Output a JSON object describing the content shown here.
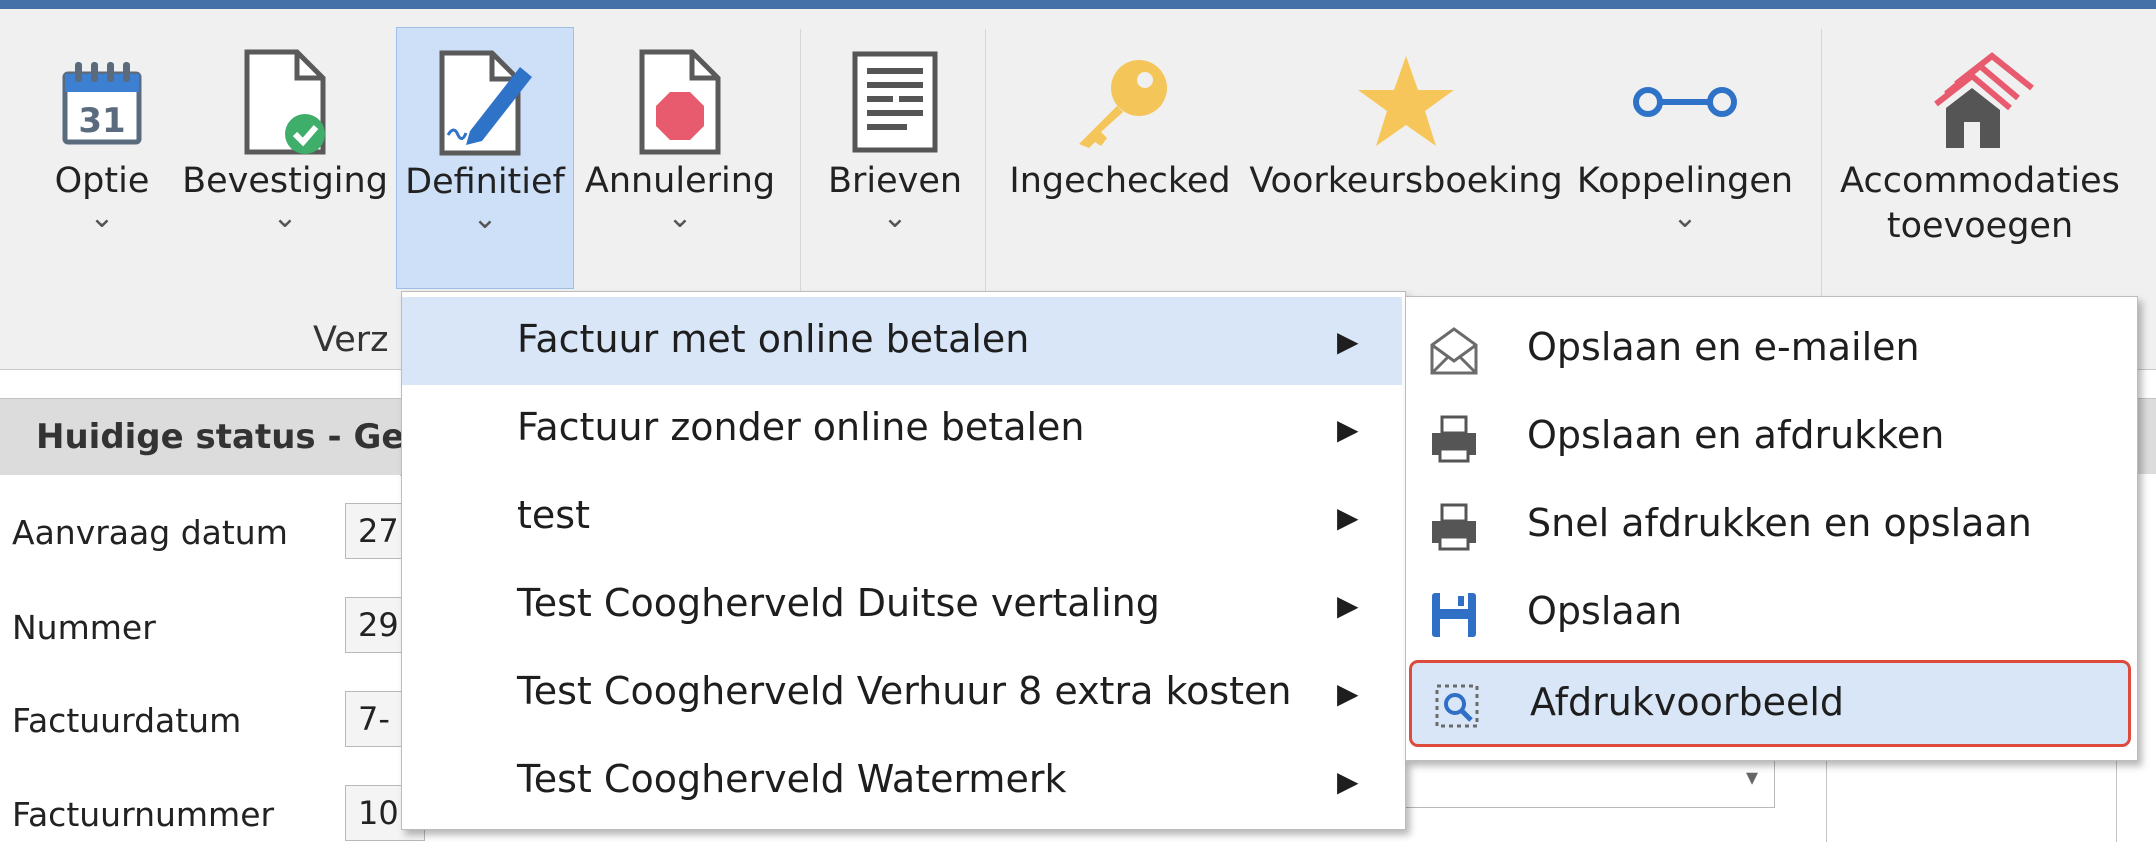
{
  "ribbon": {
    "buttons": [
      {
        "label": "Optie",
        "icon": "calendar-icon",
        "has_dropdown": true,
        "active": false
      },
      {
        "label": "Bevestiging",
        "icon": "document-check-icon",
        "has_dropdown": true,
        "active": false
      },
      {
        "label": "Definitief",
        "icon": "document-sign-icon",
        "has_dropdown": true,
        "active": true
      },
      {
        "label": "Annulering",
        "icon": "document-stop-icon",
        "has_dropdown": true,
        "active": false
      },
      {
        "label": "Brieven",
        "icon": "letters-icon",
        "has_dropdown": true,
        "active": false
      },
      {
        "label": "Ingechecked",
        "icon": "key-icon",
        "has_dropdown": false,
        "active": false
      },
      {
        "label": "Voorkeursboeking",
        "icon": "star-icon",
        "has_dropdown": false,
        "active": false
      },
      {
        "label": "Koppelingen",
        "icon": "link-icon",
        "has_dropdown": true,
        "active": false
      },
      {
        "label": "Accommodaties toevoegen",
        "label_line1": "Accommodaties",
        "label_line2": "toevoegen",
        "icon": "houses-icon",
        "has_dropdown": false,
        "active": false
      }
    ],
    "group_label_partial": "Verz"
  },
  "status": {
    "title_partial": "Huidige status - Ge"
  },
  "form": {
    "rows": [
      {
        "label": "Aanvraag datum",
        "value_partial": "27"
      },
      {
        "label": "Nummer",
        "value_partial": "29"
      },
      {
        "label": "Factuurdatum",
        "value_partial": "7-"
      },
      {
        "label": "Factuurnummer",
        "value_partial": "10"
      }
    ]
  },
  "menu": {
    "items": [
      {
        "label": "Factuur met online betalen",
        "hover": true
      },
      {
        "label": "Factuur zonder online betalen",
        "hover": false
      },
      {
        "label": "test",
        "hover": false
      },
      {
        "label": "Test Coogherveld Duitse vertaling",
        "hover": false
      },
      {
        "label": "Test Coogherveld Verhuur 8 extra kosten",
        "hover": false
      },
      {
        "label": "Test Coogherveld Watermerk",
        "hover": false
      }
    ],
    "submenu_arrow": "▶"
  },
  "submenu": {
    "items": [
      {
        "label": "Opslaan en e-mailen",
        "icon": "envelope-icon"
      },
      {
        "label": "Opslaan en afdrukken",
        "icon": "printer-icon"
      },
      {
        "label": "Snel afdrukken en opslaan",
        "icon": "printer-icon"
      },
      {
        "label": "Opslaan",
        "icon": "save-icon"
      },
      {
        "label": "Afdrukvoorbeeld",
        "icon": "print-preview-icon",
        "selected": true
      }
    ]
  },
  "colors": {
    "accent_blue": "#4472a8",
    "hover_bg": "#d8e6f8",
    "highlight_border": "#dc4b3c"
  }
}
